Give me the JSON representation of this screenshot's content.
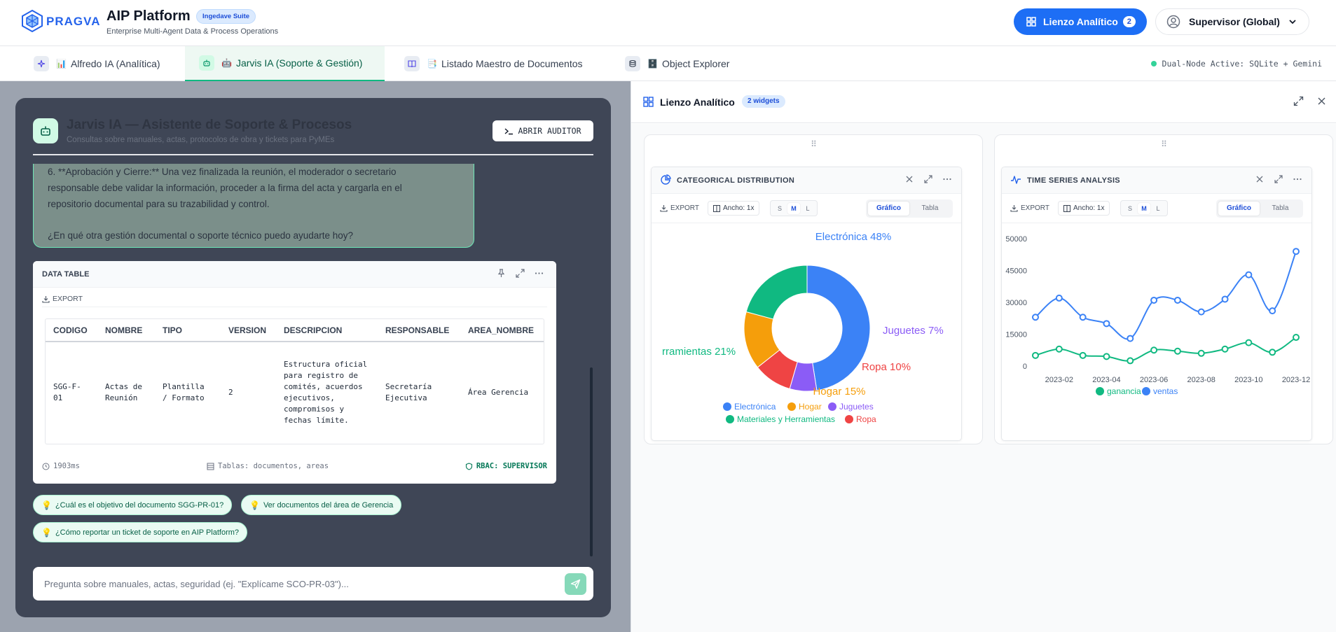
{
  "header": {
    "logo_text": "PRAGVA",
    "app_title": "AIP Platform",
    "suite_badge": "Ingedave Suite",
    "subtitle": "Enterprise Multi-Agent Data & Process Operations",
    "canvas_button": {
      "label": "Lienzo Analítico",
      "count": "2",
      "icon": "grid-icon"
    },
    "user": {
      "label": "Supervisor (Global)",
      "icon": "user-circle-icon"
    }
  },
  "tabs": [
    {
      "label": "Alfredo IA (Analítica)",
      "emoji": "📊",
      "icon": "sparkle-icon",
      "active": false
    },
    {
      "label": "Jarvis IA (Soporte & Gestión)",
      "emoji": "🤖",
      "icon": "bot-icon",
      "active": true
    },
    {
      "label": "Listado Maestro de Documentos",
      "emoji": "📑",
      "icon": "book-icon",
      "active": false
    },
    {
      "label": "Object Explorer",
      "emoji": "🗄️",
      "icon": "database-icon",
      "active": false
    }
  ],
  "node_status": "Dual-Node Active: SQLite + Gemini",
  "chat": {
    "title": "Jarvis IA — Asistente de Soporte & Procesos",
    "subtitle": "Consultas sobre manuales, actas, protocolos de obra y tickets para PyMEs",
    "auditor_button": "ABRIR AUDITOR",
    "message_line1": "6. **Aprobación y Cierre:** Una vez finalizada la reunión, el moderador o secretario",
    "message_line2": "responsable debe validar la información, proceder a la firma del acta y cargarla en el",
    "message_line3": "repositorio documental para su trazabilidad y control.",
    "message_line4": "¿En qué otra gestión documental o soporte técnico puedo ayudarte hoy?",
    "data_table": {
      "title": "DATA TABLE",
      "export_label": "EXPORT",
      "columns": [
        "CODIGO",
        "NOMBRE",
        "TIPO",
        "VERSION",
        "DESCRIPCION",
        "RESPONSABLE",
        "AREA_NOMBRE"
      ],
      "row": {
        "codigo": "SGG-F-01",
        "nombre": "Actas de Reunión",
        "tipo": "Plantilla / Formato",
        "version": "2",
        "descripcion": "Estructura oficial para registro de comités, acuerdos ejecutivos, compromisos y fechas límite.",
        "responsable": "Secretaría Ejecutiva",
        "area": "Área Gerencia"
      },
      "latency": "1903ms",
      "tables": "Tablas: documentos, areas",
      "rbac": "RBAC: SUPERVISOR"
    },
    "suggestions": [
      "¿Cuál es el objetivo del documento SGG-PR-01?",
      "Ver documentos del área de Gerencia",
      "¿Cómo reportar un ticket de soporte en AIP Platform?"
    ],
    "input_placeholder": "Pregunta sobre manuales, actas, seguridad (ej. \"Explícame SCO-PR-03\")..."
  },
  "canvas": {
    "title": "Lienzo Analítico",
    "widgets_badge": "2 widgets",
    "widget_common": {
      "export_label": "EXPORT",
      "width_label": "Ancho: 1x",
      "sizes": [
        "S",
        "M",
        "L"
      ],
      "view_chart": "Gráfico",
      "view_table": "Tabla"
    },
    "widgets": [
      {
        "title": "CATEGORICAL DISTRIBUTION",
        "icon": "pie-chart-icon"
      },
      {
        "title": "TIME SERIES ANALYSIS",
        "icon": "activity-icon"
      }
    ]
  },
  "chart_data": [
    {
      "type": "pie",
      "title": "CATEGORICAL DISTRIBUTION",
      "donut": true,
      "categories": [
        "Electrónica",
        "Juguetes",
        "Ropa",
        "Hogar",
        "Materiales y Herramientas"
      ],
      "values": [
        48,
        7,
        10,
        15,
        21
      ],
      "slice_labels": [
        "Electrónica 48%",
        "Juguetes 7%",
        "Ropa 10%",
        "Hogar 15%",
        "rramientas 21%"
      ],
      "legend": [
        "Electrónica",
        "Hogar",
        "Juguetes",
        "Materiales y Herramientas",
        "Ropa"
      ],
      "colors": {
        "Electrónica": "#3b82f6",
        "Juguetes": "#8b5cf6",
        "Ropa": "#ef4444",
        "Hogar": "#f59e0b",
        "Materiales y Herramientas": "#10b981"
      },
      "legend_position": "bottom"
    },
    {
      "type": "line",
      "title": "TIME SERIES ANALYSIS",
      "x": [
        "2023-01",
        "2023-02",
        "2023-03",
        "2023-04",
        "2023-05",
        "2023-06",
        "2023-07",
        "2023-08",
        "2023-09",
        "2023-10",
        "2023-11",
        "2023-12"
      ],
      "xticks": [
        "2023-02",
        "2023-04",
        "2023-06",
        "2023-08",
        "2023-10",
        "2023-12"
      ],
      "yticks": [
        "0",
        "15000",
        "30000",
        "45000",
        "60000"
      ],
      "ytick_labels": [
        "0",
        "15000",
        "30000",
        "45000",
        "50000"
      ],
      "ylim": [
        0,
        60000
      ],
      "series": [
        {
          "name": "ventas",
          "color": "#3b82f6",
          "values": [
            23000,
            32000,
            23000,
            20000,
            13000,
            31000,
            31000,
            25500,
            31500,
            43000,
            26000,
            54000
          ]
        },
        {
          "name": "ganancia",
          "color": "#10b981",
          "values": [
            5000,
            8000,
            5000,
            4500,
            2500,
            7500,
            7000,
            6000,
            8000,
            11000,
            6500,
            13500
          ]
        }
      ],
      "legend": [
        "ganancia",
        "ventas"
      ],
      "legend_position": "bottom",
      "grid": false
    }
  ]
}
